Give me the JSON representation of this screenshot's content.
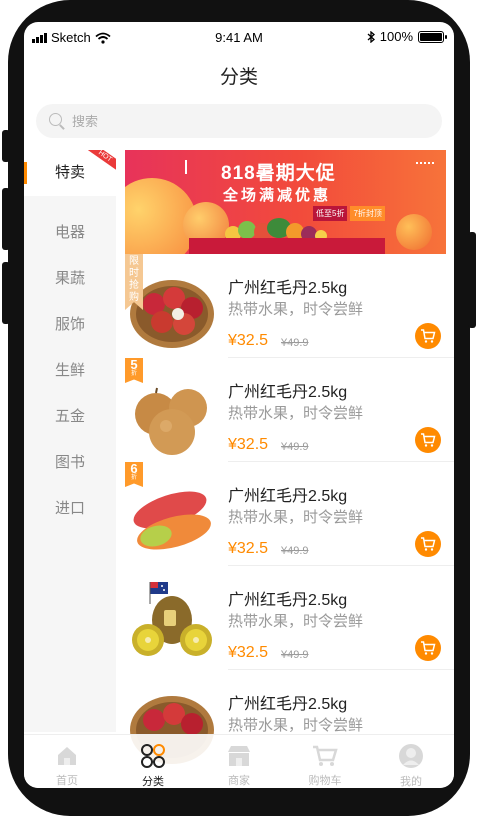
{
  "status_bar": {
    "carrier": "Sketch",
    "time": "9:41 AM",
    "battery": "100%"
  },
  "header": {
    "title": "分类"
  },
  "search": {
    "placeholder": "搜索"
  },
  "sidebar": {
    "hot_tag": "HOT",
    "items": [
      {
        "label": "特卖",
        "active": true
      },
      {
        "label": "电器"
      },
      {
        "label": "果蔬"
      },
      {
        "label": "服饰"
      },
      {
        "label": "生鲜"
      },
      {
        "label": "五金"
      },
      {
        "label": "图书"
      },
      {
        "label": "进口"
      }
    ]
  },
  "banner": {
    "title": "818暑期大促",
    "subtitle": "全场满减优惠",
    "deal_1": "低至5折",
    "deal_2": "7折封顶"
  },
  "products": [
    {
      "name": "广州红毛丹2.5kg",
      "desc": "热带水果，时令尝鲜",
      "price": "¥32.5",
      "old_price": "¥49.9",
      "tag": "限时抢购",
      "image": "rambutan-basket"
    },
    {
      "name": "广州红毛丹2.5kg",
      "desc": "热带水果，时令尝鲜",
      "price": "¥32.5",
      "old_price": "¥49.9",
      "tag": "5",
      "tag_unit": "折",
      "image": "asian-pears"
    },
    {
      "name": "广州红毛丹2.5kg",
      "desc": "热带水果，时令尝鲜",
      "price": "¥32.5",
      "old_price": "¥49.9",
      "tag": "6",
      "tag_unit": "折",
      "image": "mangoes"
    },
    {
      "name": "广州红毛丹2.5kg",
      "desc": "热带水果，时令尝鲜",
      "price": "¥32.5",
      "old_price": "¥49.9",
      "image": "golden-kiwi-australia-flag"
    },
    {
      "name": "广州红毛丹2.5kg",
      "desc": "热带水果，时令尝鲜",
      "image": "rambutan-basket"
    }
  ],
  "tabbar": [
    {
      "label": "首页",
      "icon": "home-icon"
    },
    {
      "label": "分类",
      "icon": "category-icon",
      "active": true
    },
    {
      "label": "商家",
      "icon": "store-icon"
    },
    {
      "label": "购物车",
      "icon": "cart-icon"
    },
    {
      "label": "我的",
      "icon": "user-icon"
    }
  ],
  "colors": {
    "accent": "#ff8a00",
    "hot": "#ea3a3a",
    "banner_start": "#e7335a",
    "banner_end": "#f7733a"
  }
}
